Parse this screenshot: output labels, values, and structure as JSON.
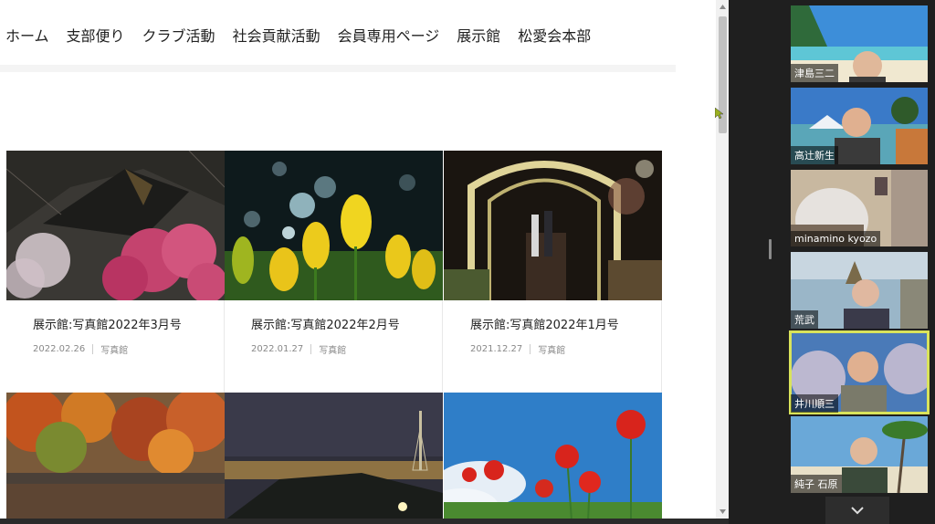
{
  "nav": {
    "items": [
      "ホーム",
      "支部便り",
      "クラブ活動",
      "社会貢献活動",
      "会員専用ページ",
      "展示館",
      "松愛会本部"
    ]
  },
  "cards": [
    {
      "title": "展示館:写真館2022年3月号",
      "date": "2022.02.26",
      "category": "写真館",
      "image": "plum-blossoms-roof"
    },
    {
      "title": "展示館:写真館2022年2月号",
      "date": "2022.01.27",
      "category": "写真館",
      "image": "yellow-tulips"
    },
    {
      "title": "展示館:写真館2022年1月号",
      "date": "2021.12.27",
      "category": "写真館",
      "image": "illuminated-tunnel"
    }
  ],
  "cards_row2": [
    {
      "image": "autumn-lake"
    },
    {
      "image": "night-city-tower"
    },
    {
      "image": "red-spider-lilies"
    }
  ],
  "participants": [
    {
      "name": "津島三二",
      "background": "beach"
    },
    {
      "name": "高辻新生",
      "background": "coast-mountain"
    },
    {
      "name": "minamino kyozo",
      "background": "room"
    },
    {
      "name": "荒武",
      "background": "seaside-cliff"
    },
    {
      "name": "井川順三",
      "background": "blossom-tree",
      "active": true
    },
    {
      "name": "純子 石原",
      "background": "palm-beach"
    }
  ],
  "colors": {
    "active_speaker": "#d9e35b",
    "panel_bg": "#1f1f1f"
  }
}
